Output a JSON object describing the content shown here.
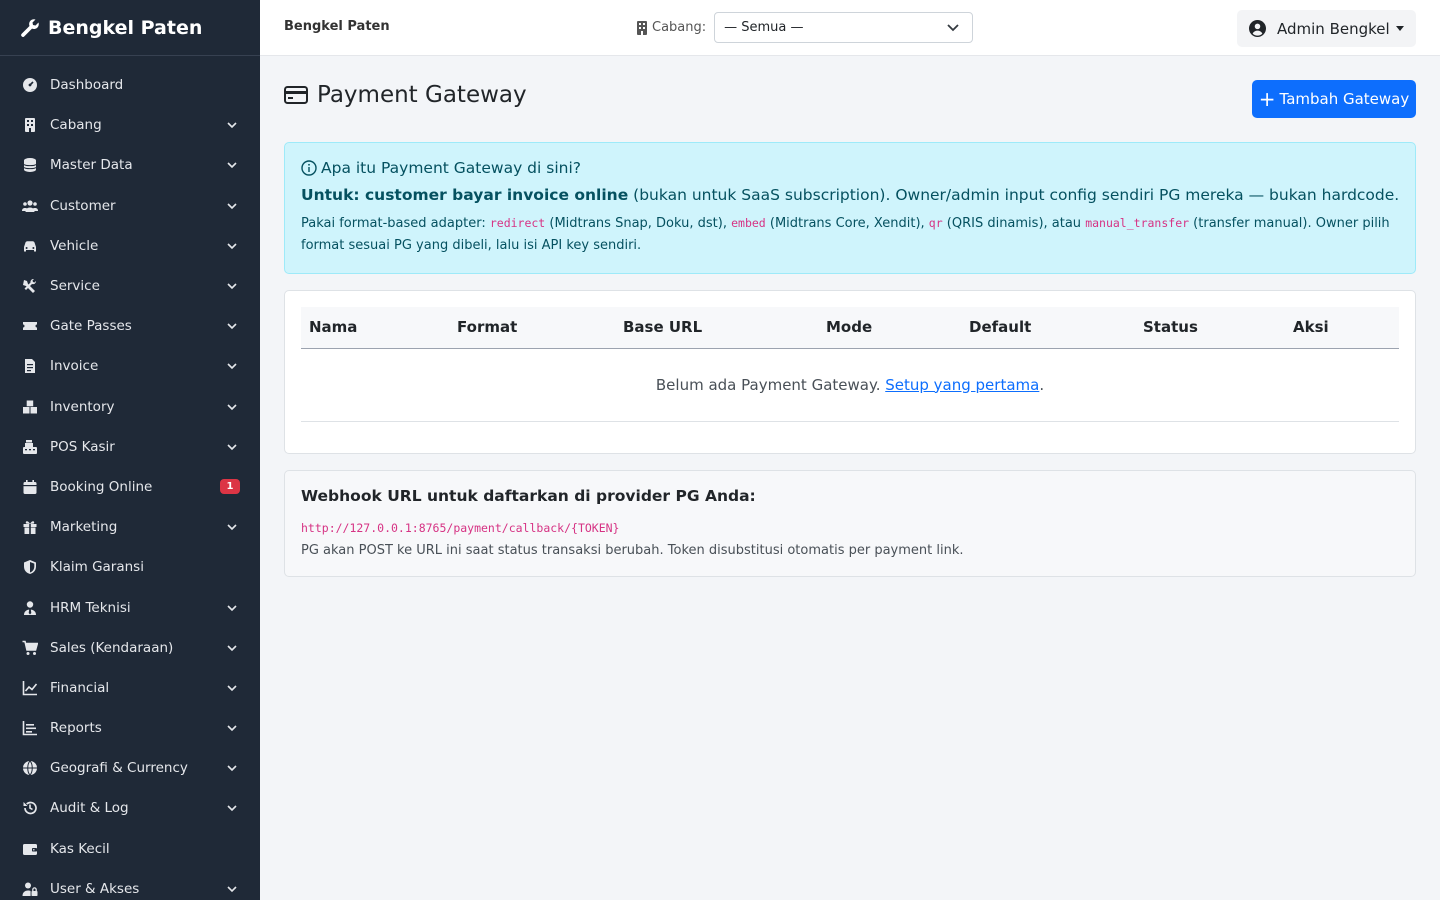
{
  "brand": {
    "name": "Bengkel Paten",
    "icon": "wrench-icon"
  },
  "sidebar": {
    "items": [
      {
        "label": "Dashboard",
        "icon": "gauge-icon",
        "chevron": false
      },
      {
        "label": "Cabang",
        "icon": "building-icon",
        "chevron": true
      },
      {
        "label": "Master Data",
        "icon": "database-icon",
        "chevron": true
      },
      {
        "label": "Customer",
        "icon": "users-icon",
        "chevron": true
      },
      {
        "label": "Vehicle",
        "icon": "car-icon",
        "chevron": true
      },
      {
        "label": "Service",
        "icon": "tools-icon",
        "chevron": true
      },
      {
        "label": "Gate Passes",
        "icon": "ticket-icon",
        "chevron": true
      },
      {
        "label": "Invoice",
        "icon": "file-invoice-icon",
        "chevron": true
      },
      {
        "label": "Inventory",
        "icon": "boxes-icon",
        "chevron": true
      },
      {
        "label": "POS Kasir",
        "icon": "cash-register-icon",
        "chevron": true
      },
      {
        "label": "Booking Online",
        "icon": "calendar-icon",
        "chevron": false,
        "badge": "1"
      },
      {
        "label": "Marketing",
        "icon": "gift-icon",
        "chevron": true
      },
      {
        "label": "Klaim Garansi",
        "icon": "shield-icon",
        "chevron": false
      },
      {
        "label": "HRM Teknisi",
        "icon": "user-tie-icon",
        "chevron": true
      },
      {
        "label": "Sales (Kendaraan)",
        "icon": "cart-icon",
        "chevron": true
      },
      {
        "label": "Financial",
        "icon": "line-chart-icon",
        "chevron": true
      },
      {
        "label": "Reports",
        "icon": "bar-list-icon",
        "chevron": true
      },
      {
        "label": "Geografi & Currency",
        "icon": "globe-icon",
        "chevron": true
      },
      {
        "label": "Audit & Log",
        "icon": "history-icon",
        "chevron": true
      },
      {
        "label": "Kas Kecil",
        "icon": "wallet-icon",
        "chevron": false
      },
      {
        "label": "User & Akses",
        "icon": "user-lock-icon",
        "chevron": true
      }
    ]
  },
  "topbar": {
    "title": "Bengkel Paten",
    "branch_label": "Cabang:",
    "branch_value": "— Semua —",
    "user_name": "Admin Bengkel"
  },
  "page": {
    "title": "Payment Gateway",
    "add_button": "Tambah Gateway"
  },
  "info": {
    "heading": "Apa itu Payment Gateway di sini?",
    "line1_bold": "Untuk: customer bayar invoice online",
    "line1_rest": " (bukan untuk SaaS subscription). Owner/admin input config sendiri PG mereka — bukan hardcode.",
    "line2_a": "Pakai format-based adapter: ",
    "code_redirect": "redirect",
    "line2_b": " (Midtrans Snap, Doku, dst), ",
    "code_embed": "embed",
    "line2_c": " (Midtrans Core, Xendit), ",
    "code_qr": "qr",
    "line2_d": " (QRIS dinamis), atau ",
    "code_manual": "manual_transfer",
    "line2_e": " (transfer manual). Owner pilih format sesuai PG yang dibeli, lalu isi API key sendiri."
  },
  "table": {
    "columns": [
      "Nama",
      "Format",
      "Base URL",
      "Mode",
      "Default",
      "Status",
      "Aksi"
    ],
    "empty_text": "Belum ada Payment Gateway. ",
    "empty_link": "Setup yang pertama",
    "empty_suffix": "."
  },
  "webhook": {
    "title": "Webhook URL untuk daftarkan di provider PG Anda:",
    "url": "http://127.0.0.1:8765/payment/callback/{TOKEN}",
    "note": "PG akan POST ke URL ini saat status transaksi berubah. Token disubstitusi otomatis per payment link."
  },
  "colors": {
    "sidebar_bg": "#1f2937",
    "primary": "#0d6efd",
    "info_bg": "#cff4fc",
    "info_text": "#055160",
    "badge": "#dc3545",
    "code": "#d63384"
  }
}
